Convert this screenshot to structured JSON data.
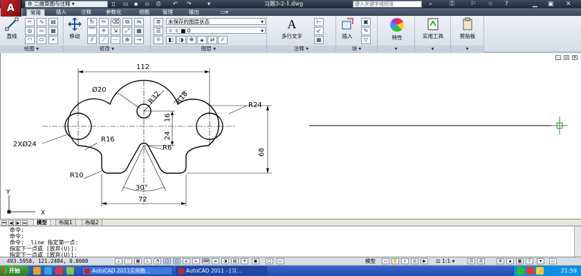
{
  "window": {
    "workspace": "二维草图与注释",
    "document_title": "习题3-2-1.dwg",
    "search_placeholder": "键入关键字或短语"
  },
  "ribbon_tabs": [
    "常用",
    "插入",
    "注释",
    "参数化",
    "视图",
    "管理",
    "输出"
  ],
  "ribbon": {
    "draw_label": "绘图",
    "line_label": "直线",
    "modify_label": "修改",
    "move_label": "移动",
    "layers_label": "图层",
    "layer_state": "未保存的图层状态",
    "current_layer": "0",
    "annotation_label": "注释",
    "multiline_text_label": "多行文字",
    "block_label": "块",
    "insert_label": "插入",
    "properties_label": "特性",
    "utilities_label": "实用工具",
    "clipboard_label": "剪贴板"
  },
  "drawing": {
    "dims": {
      "top_width": "112",
      "small_dia": "Ø20",
      "r32": "R32",
      "r18": "R18",
      "r24": "R24",
      "d16": "16",
      "d24": "24",
      "two_dia24": "2XØ24",
      "r16": "R16",
      "r6": "R6",
      "height68": "68",
      "r10": "R10",
      "angle30": "30°",
      "bottom72": "72"
    },
    "ucs_x": "X",
    "ucs_y": "Y"
  },
  "layout_tabs": [
    "模型",
    "布局1",
    "布局2"
  ],
  "command_lines": [
    "命令:",
    "命令:",
    "命令: _line 指定第一点:",
    "指定下一点或 [放弃(U)]:",
    "指定下一点或 [放弃(U)]:"
  ],
  "status": {
    "coords": "493.5958, 121.2484, 0.0000",
    "model": "模型",
    "scale": "1:1"
  },
  "taskbar": {
    "start": "开始",
    "windows": [
      "AutoCAD 2011实例教...",
      "AutoCAD 2011 - [习..."
    ],
    "clock": "21:59"
  }
}
